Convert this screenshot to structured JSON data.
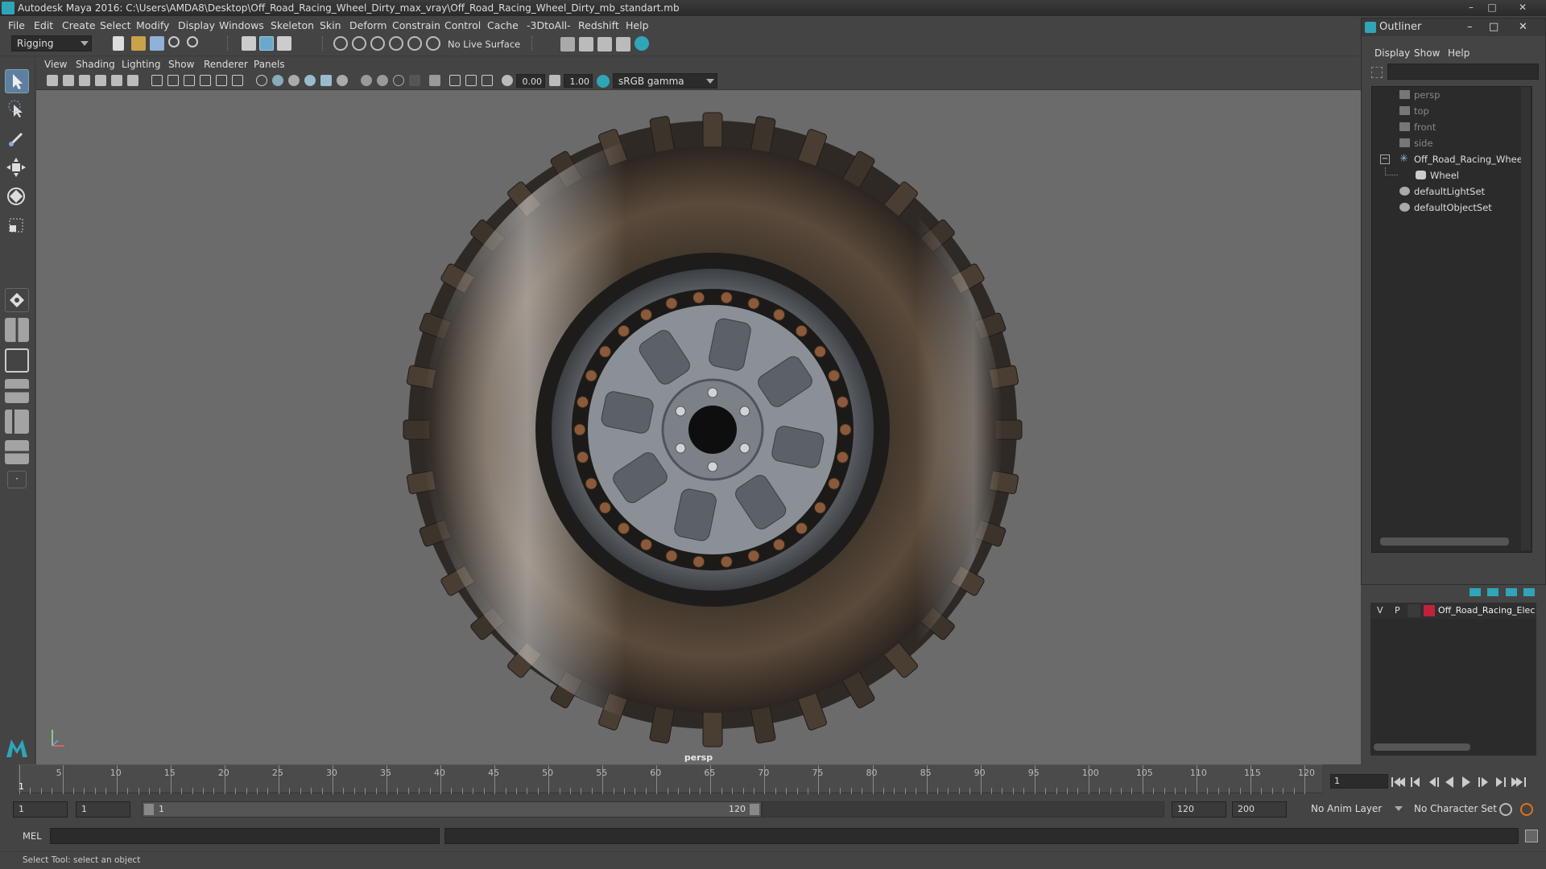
{
  "window": {
    "title": "Autodesk Maya 2016: C:\\Users\\AMDA8\\Desktop\\Off_Road_Racing_Wheel_Dirty_max_vray\\Off_Road_Racing_Wheel_Dirty_mb_standart.mb",
    "controls": [
      "–",
      "□",
      "✕"
    ]
  },
  "menubar": [
    "File",
    "Edit",
    "Create",
    "Select",
    "Modify",
    "Display",
    "Windows",
    "Skeleton",
    "Skin",
    "Deform",
    "Constrain",
    "Control",
    "Cache",
    "-3DtoAll-",
    "Redshift",
    "Help"
  ],
  "statusline": {
    "menuset": "Rigging",
    "live_surface": "No Live Surface"
  },
  "panel": {
    "menus": [
      "View",
      "Shading",
      "Lighting",
      "Show",
      "Renderer",
      "Panels"
    ],
    "exposure": "0.00",
    "gamma": "1.00",
    "color_space": "sRGB gamma",
    "camera_label": "persp"
  },
  "outliner": {
    "title": "Outliner",
    "menus": [
      "Display",
      "Show",
      "Help"
    ],
    "items": [
      {
        "label": "persp",
        "icon": "camera-icon",
        "dim": true
      },
      {
        "label": "top",
        "icon": "camera-icon",
        "dim": true
      },
      {
        "label": "front",
        "icon": "camera-icon",
        "dim": true
      },
      {
        "label": "side",
        "icon": "camera-icon",
        "dim": true
      },
      {
        "label": "Off_Road_Racing_Wheel_I",
        "icon": "group-icon",
        "dim": false,
        "expander": "−"
      },
      {
        "label": "Wheel",
        "icon": "mesh-icon",
        "dim": false
      },
      {
        "label": "defaultLightSet",
        "icon": "set-icon",
        "dim": false
      },
      {
        "label": "defaultObjectSet",
        "icon": "set-icon",
        "dim": false
      }
    ]
  },
  "layers": {
    "visible": "V",
    "playback": "P",
    "name": "Off_Road_Racing_Elec",
    "color": "#c0223a"
  },
  "timeslider": {
    "tick_labels": [
      "1",
      "5",
      "10",
      "15",
      "20",
      "25",
      "30",
      "35",
      "40",
      "45",
      "50",
      "55",
      "60",
      "65",
      "70",
      "75",
      "80",
      "85",
      "90",
      "95",
      "100",
      "105",
      "110",
      "115",
      "120"
    ],
    "current_frame": "1"
  },
  "rangebar": {
    "start": "1",
    "playback_start": "1",
    "slider_start": "1",
    "slider_end": "120",
    "playback_end": "120",
    "end": "200",
    "anim_layer": "No Anim Layer",
    "character_set": "No Character Set"
  },
  "cmdline": {
    "lang": "MEL"
  },
  "helpline": "Select Tool: select an object",
  "colors": {
    "accent": "#2fa5b8",
    "viewport_bg": "#6b6b6b"
  }
}
